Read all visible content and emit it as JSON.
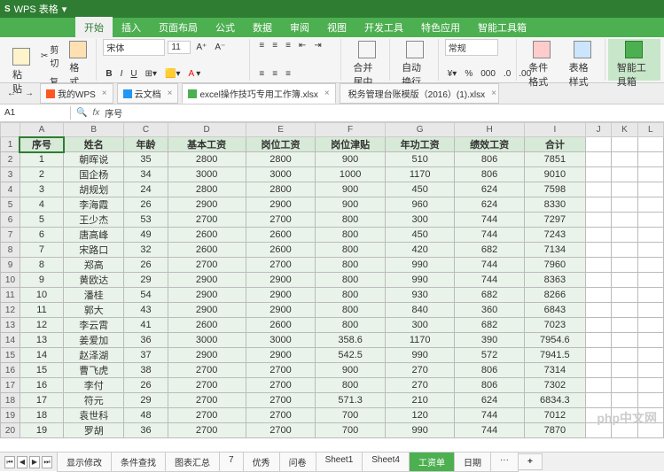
{
  "app": {
    "name": "WPS 表格",
    "logo": "S"
  },
  "menu": {
    "tabs": [
      "开始",
      "插入",
      "页面布局",
      "公式",
      "数据",
      "审阅",
      "视图",
      "开发工具",
      "特色应用",
      "智能工具箱"
    ],
    "active": 0
  },
  "ribbon": {
    "clipboard": {
      "cut": "剪切",
      "copy": "复制",
      "paste": "粘贴",
      "format_painter": "格式刷"
    },
    "font": {
      "name": "宋体",
      "size": "11",
      "bold": "B",
      "italic": "I",
      "underline": "U"
    },
    "merge": {
      "label": "合并居中",
      "wrap": "自动换行"
    },
    "number": {
      "format": "常规"
    },
    "styles": {
      "cond_format": "条件格式",
      "table_style": "表格样式"
    },
    "tools": {
      "smart": "智能工具箱"
    }
  },
  "doctabs": {
    "items": [
      {
        "label": "我的WPS",
        "icon": "wps"
      },
      {
        "label": "云文档",
        "icon": "cloud"
      },
      {
        "label": "excel操作技巧专用工作簿.xlsx",
        "icon": "xls"
      },
      {
        "label": "税务管理台账模版（2016）(1).xlsx",
        "icon": "xls"
      }
    ],
    "active": 2
  },
  "formula_bar": {
    "cell_ref": "A1",
    "fx": "fx",
    "value": "序号"
  },
  "columns": [
    "A",
    "B",
    "C",
    "D",
    "E",
    "F",
    "G",
    "H",
    "I",
    "J",
    "K",
    "L"
  ],
  "chart_data": {
    "type": "table",
    "headers": [
      "序号",
      "姓名",
      "年龄",
      "基本工资",
      "岗位工资",
      "岗位津贴",
      "年功工资",
      "绩效工资",
      "合计"
    ],
    "rows": [
      [
        1,
        "朝晖说",
        35,
        2800,
        2800,
        900,
        510,
        806,
        7851
      ],
      [
        2,
        "国企杨",
        34,
        3000,
        3000,
        1000,
        1170,
        806,
        9010
      ],
      [
        3,
        "胡规划",
        24,
        2800,
        2800,
        900,
        450,
        624,
        7598
      ],
      [
        4,
        "李海霞",
        26,
        2900,
        2900,
        900,
        960,
        624,
        8330
      ],
      [
        5,
        "王少杰",
        53,
        2700,
        2700,
        800,
        300,
        744,
        7297
      ],
      [
        6,
        "唐高峰",
        49,
        2600,
        2600,
        800,
        450,
        744,
        7243
      ],
      [
        7,
        "宋路口",
        32,
        2600,
        2600,
        800,
        420,
        682,
        7134
      ],
      [
        8,
        "郑高",
        26,
        2700,
        2700,
        800,
        990,
        744,
        7960
      ],
      [
        9,
        "黄欧达",
        29,
        2900,
        2900,
        800,
        990,
        744,
        8363
      ],
      [
        10,
        "潘桂",
        54,
        2900,
        2900,
        800,
        930,
        682,
        8266
      ],
      [
        11,
        "郭大",
        43,
        2900,
        2900,
        800,
        840,
        360,
        6843
      ],
      [
        12,
        "李云霄",
        41,
        2600,
        2600,
        800,
        300,
        682,
        7023
      ],
      [
        13,
        "姜爱加",
        36,
        3000,
        3000,
        358.6,
        1170,
        390,
        7954.6
      ],
      [
        14,
        "赵泽湖",
        37,
        2900,
        2900,
        542.5,
        990,
        572,
        7941.5
      ],
      [
        15,
        "曹飞虎",
        38,
        2700,
        2700,
        900,
        270,
        806,
        7314
      ],
      [
        16,
        "李付",
        26,
        2700,
        2700,
        800,
        270,
        806,
        7302
      ],
      [
        17,
        "符元",
        29,
        2700,
        2700,
        571.3,
        210,
        624,
        6834.3
      ],
      [
        18,
        "袁世科",
        48,
        2700,
        2700,
        700,
        120,
        744,
        7012
      ],
      [
        19,
        "罗胡",
        36,
        2700,
        2700,
        700,
        990,
        744,
        7870
      ]
    ]
  },
  "sheet_tabs": {
    "items": [
      "显示修改",
      "条件查找",
      "图表汇总",
      "7",
      "优秀",
      "问卷",
      "Sheet1",
      "Sheet4",
      "工资单",
      "日期",
      "···"
    ],
    "active": 8,
    "add": "+"
  },
  "watermark": "php中文网"
}
